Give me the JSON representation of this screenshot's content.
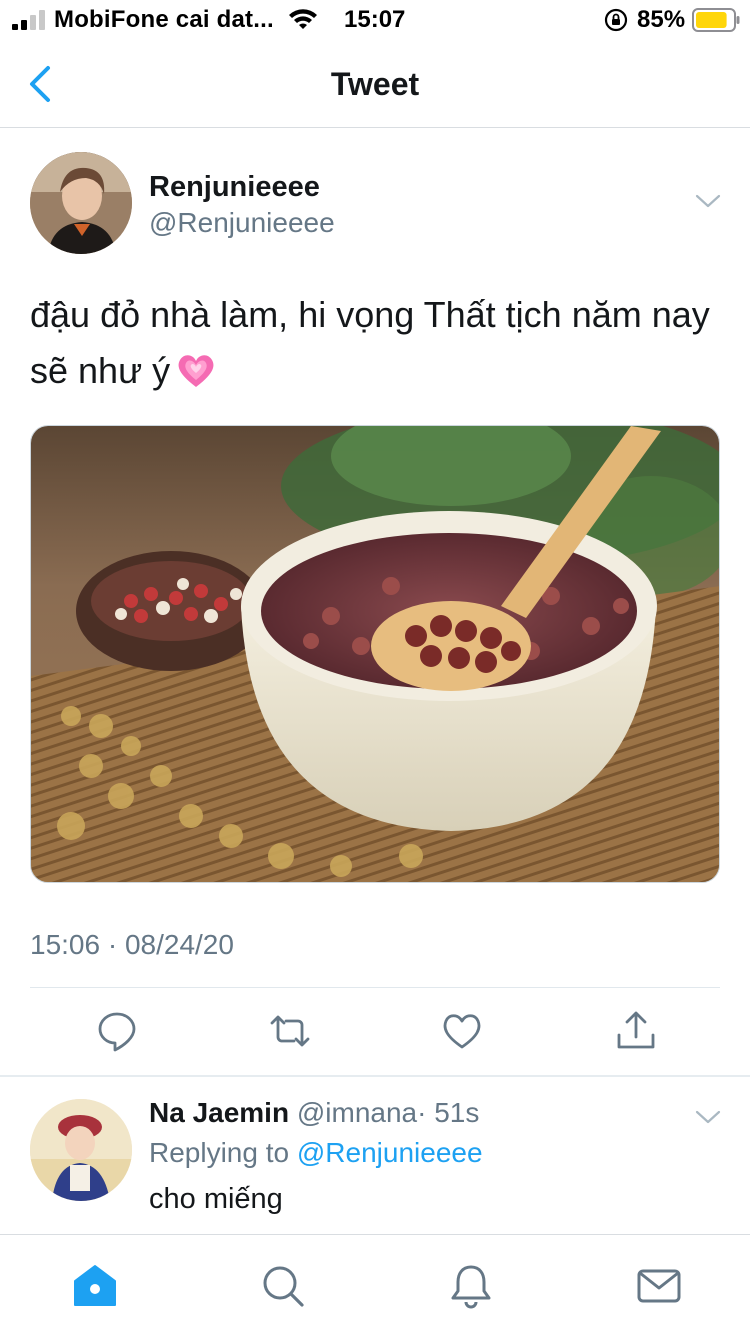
{
  "status_bar": {
    "carrier": "MobiFone cai dat...",
    "time": "15:07",
    "battery": "85%",
    "battery_level": 0.85,
    "battery_color": "#ffd60a"
  },
  "nav": {
    "title": "Tweet",
    "accent_color": "#1da1f2"
  },
  "tweet": {
    "author_name": "Renjunieeee",
    "author_handle": "@Renjunieeee",
    "text": "đậu đỏ nhà làm, hi vọng Thất tịch năm nay sẽ như ý",
    "emoji": "growing-heart-icon",
    "timestamp": "15:06 · 08/24/20"
  },
  "actions": {
    "icons": [
      "reply-icon",
      "retweet-icon",
      "like-icon",
      "share-icon"
    ]
  },
  "reply": {
    "author_name": "Na Jaemin",
    "author_handle": "@imnana",
    "time": "· 51s",
    "replying_prefix": "Replying to",
    "replying_handle": "@Renjunieeee",
    "text": "cho miếng"
  },
  "tab_bar": {
    "icons": [
      "home-icon",
      "search-icon",
      "notifications-icon",
      "messages-icon"
    ],
    "active": "home-icon"
  }
}
